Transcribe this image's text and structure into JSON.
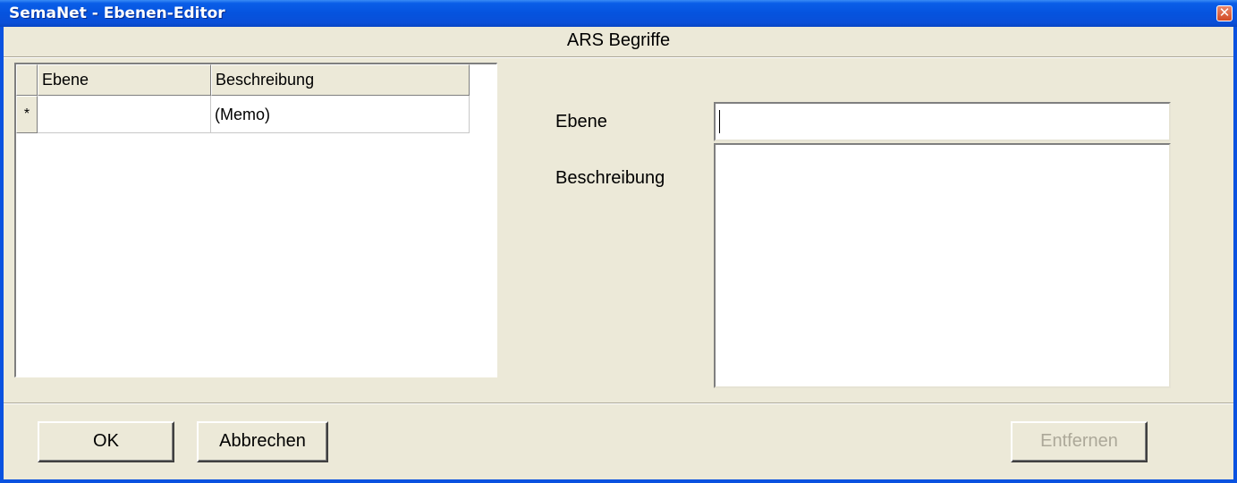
{
  "window": {
    "title": "SemaNet - Ebenen-Editor",
    "close_glyph": "✕"
  },
  "header": {
    "label": "ARS Begriffe"
  },
  "grid": {
    "columns": [
      "Ebene",
      "Beschreibung"
    ],
    "rows": [
      {
        "marker": "*",
        "ebene": "",
        "beschreibung": "(Memo)"
      }
    ]
  },
  "form": {
    "ebene_label": "Ebene",
    "ebene_value": "",
    "beschreibung_label": "Beschreibung",
    "beschreibung_value": ""
  },
  "buttons": {
    "ok": "OK",
    "cancel": "Abbrechen",
    "remove": "Entfernen"
  },
  "icons": {
    "close": "close-icon"
  }
}
